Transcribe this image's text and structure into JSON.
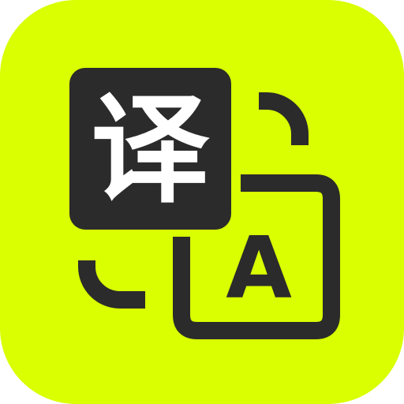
{
  "icon": {
    "name": "translate-app-icon",
    "source_glyph": "译",
    "target_glyph": "A",
    "colors": {
      "background": "#d9ff00",
      "foreground": "#2b2b2b",
      "glyph_on_dark": "#ffffff"
    }
  }
}
